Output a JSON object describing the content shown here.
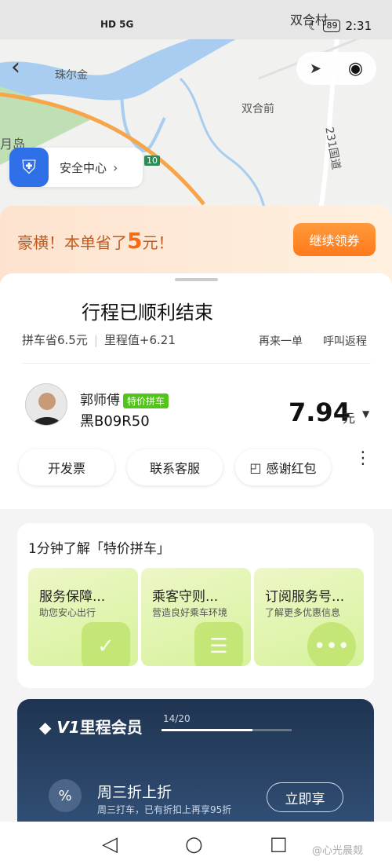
{
  "status_bar": {
    "place_label": "双合村",
    "net_icons": "HD 5G",
    "battery": "89",
    "time": "2:31"
  },
  "map": {
    "labels": [
      "珠尔金",
      "双合前",
      "月岛",
      "231国道"
    ],
    "road_number": "10"
  },
  "safety": {
    "label": "安全中心"
  },
  "promo": {
    "prefix": "豪横！本单省了",
    "amount": "5",
    "suffix": "元！",
    "button": "继续领券"
  },
  "trip": {
    "title": "行程已顺利结束",
    "saved": "拼车省6.5元",
    "mileage": "里程值+6.21",
    "again": "再来一单",
    "return_trip": "呼叫返程"
  },
  "driver": {
    "name": "郭师傅",
    "badge": "特价拼车",
    "plate": "黑B09R50",
    "price": "7.94",
    "unit": "元"
  },
  "actions": {
    "invoice": "开发票",
    "service": "联系客服",
    "thanks": "感谢红包"
  },
  "info": {
    "heading": "1分钟了解「特价拼车」",
    "tiles": [
      {
        "title": "服务保障...",
        "sub": "助您安心出行"
      },
      {
        "title": "乘客守则...",
        "sub": "营造良好乘车环境"
      },
      {
        "title": "订阅服务号...",
        "sub": "了解更多优惠信息"
      }
    ]
  },
  "member": {
    "badge": "V1",
    "title": "里程会员",
    "progress_text": "14/20",
    "progress": 0.7,
    "offer_title": "周三折上折",
    "offer_sub": "周三打车，已有折扣上再享95折",
    "button": "立即享"
  },
  "watermark": "@心光晨觌"
}
